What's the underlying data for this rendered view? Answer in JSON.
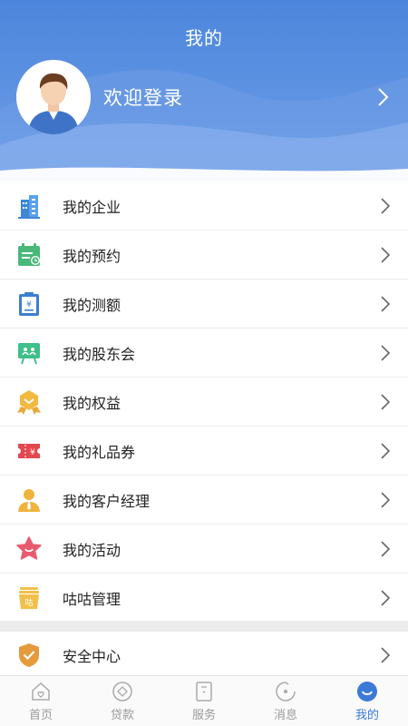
{
  "header": {
    "title": "我的"
  },
  "profile": {
    "login_text": "欢迎登录"
  },
  "menu": {
    "items": [
      {
        "label": "我的企业",
        "icon": "building-icon"
      },
      {
        "label": "我的预约",
        "icon": "calendar-icon"
      },
      {
        "label": "我的测额",
        "icon": "clipboard-yen-icon"
      },
      {
        "label": "我的股东会",
        "icon": "meeting-board-icon"
      },
      {
        "label": "我的权益",
        "icon": "badge-ribbon-icon"
      },
      {
        "label": "我的礼品券",
        "icon": "coupon-icon"
      },
      {
        "label": "我的客户经理",
        "icon": "manager-icon"
      },
      {
        "label": "我的活动",
        "icon": "star-smile-icon"
      },
      {
        "label": "咕咕管理",
        "icon": "basket-icon"
      }
    ]
  },
  "security": {
    "label": "安全中心",
    "icon": "shield-check-icon"
  },
  "tabbar": {
    "tabs": [
      {
        "label": "首页",
        "icon": "home-icon",
        "active": false
      },
      {
        "label": "贷款",
        "icon": "loan-icon",
        "active": false
      },
      {
        "label": "服务",
        "icon": "service-icon",
        "active": false
      },
      {
        "label": "消息",
        "icon": "message-icon",
        "active": false
      },
      {
        "label": "我的",
        "icon": "profile-icon",
        "active": true
      }
    ]
  },
  "colors": {
    "accent": "#3d7ad8",
    "header": "#4c86dc"
  }
}
